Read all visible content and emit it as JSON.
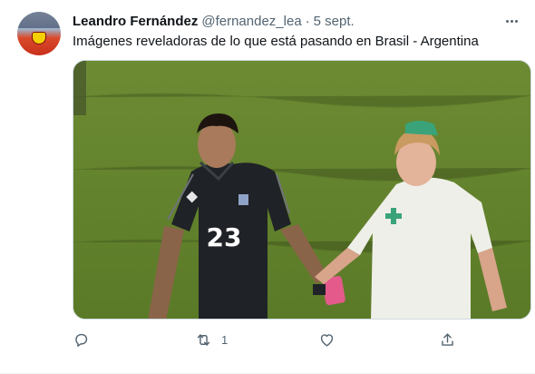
{
  "tweet": {
    "author_name": "Leandro Fernández",
    "author_handle": "@fernandez_lea",
    "separator": "·",
    "date": "5 sept.",
    "text": "Imágenes reveladoras de lo que está pasando en Brasil - Argentina",
    "media": {
      "jersey_number": "23"
    },
    "actions": {
      "reply_count": "",
      "retweet_count": "1",
      "like_count": ""
    }
  },
  "colors": {
    "text_primary": "#0f1419",
    "text_secondary": "#536471",
    "border": "#cfd9de",
    "grass": "#5f7f2c"
  },
  "icons": [
    "more-icon",
    "reply-icon",
    "retweet-icon",
    "like-icon",
    "share-icon"
  ]
}
